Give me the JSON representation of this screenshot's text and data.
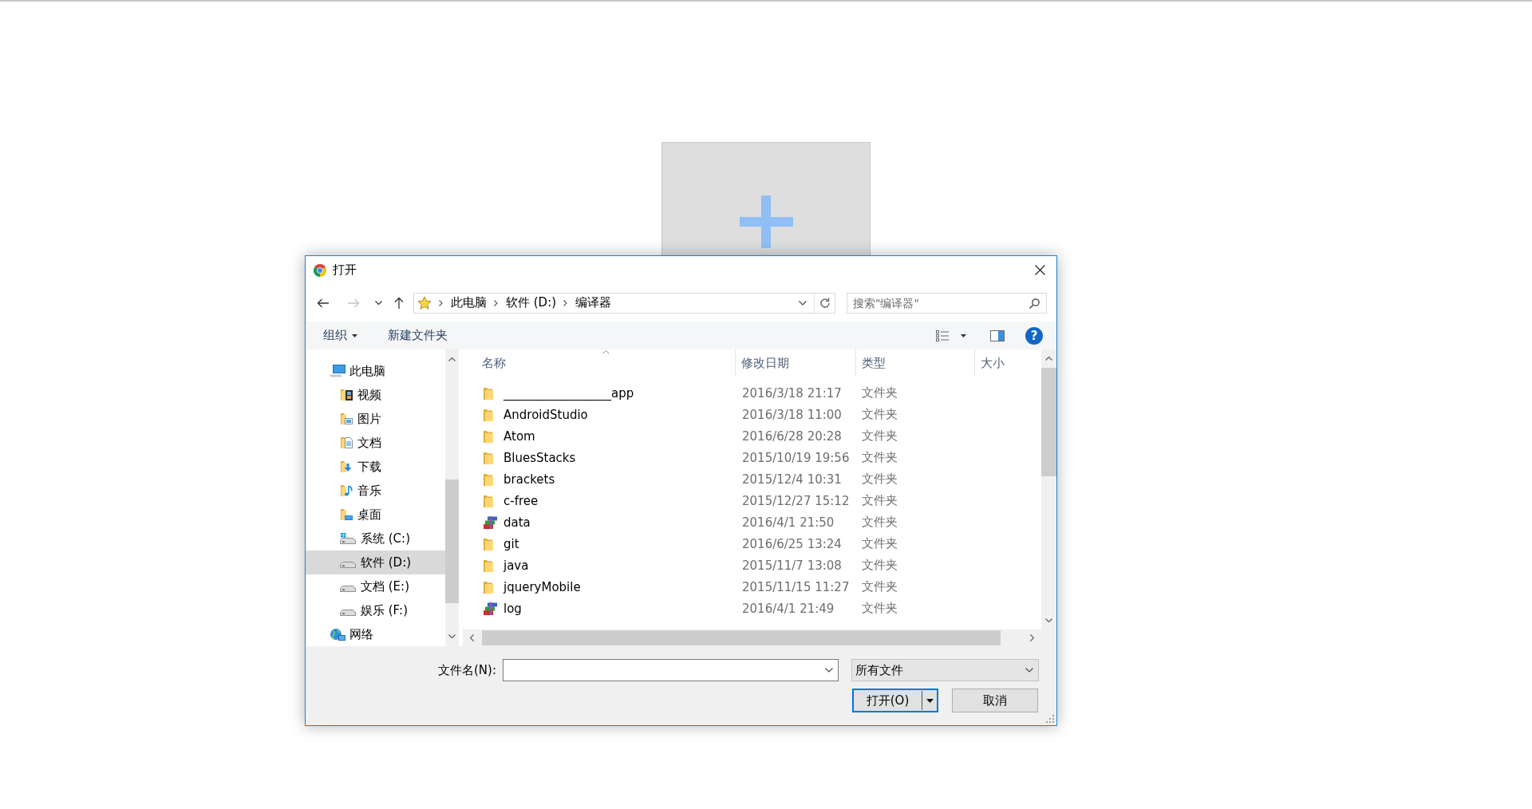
{
  "dialog": {
    "title": "打开",
    "nav": [
      {
        "kind": "back",
        "disabled": false
      },
      {
        "kind": "forward",
        "disabled": true
      },
      {
        "kind": "recent",
        "disabled": false
      },
      {
        "kind": "up",
        "disabled": false
      }
    ],
    "breadcrumb": [
      "此电脑",
      "软件 (D:)",
      "编译器"
    ],
    "search": {
      "placeholder": "搜索\"编译器\""
    },
    "toolbar": {
      "organize": "组织",
      "new_folder": "新建文件夹",
      "help": "?"
    },
    "sidebar": {
      "items": [
        {
          "label": "此电脑",
          "kind": "computer",
          "selected": false,
          "children": [
            {
              "label": "视频",
              "kind": "videos",
              "selected": false
            },
            {
              "label": "图片",
              "kind": "pictures",
              "selected": false
            },
            {
              "label": "文档",
              "kind": "documents",
              "selected": false
            },
            {
              "label": "下载",
              "kind": "downloads",
              "selected": false
            },
            {
              "label": "音乐",
              "kind": "music",
              "selected": false
            },
            {
              "label": "桌面",
              "kind": "desktop",
              "selected": false
            },
            {
              "label": "系统 (C:)",
              "kind": "systemdrive",
              "selected": false
            },
            {
              "label": "软件 (D:)",
              "kind": "drive",
              "selected": true
            },
            {
              "label": "文档 (E:)",
              "kind": "drive",
              "selected": false
            },
            {
              "label": "娱乐 (F:)",
              "kind": "drive",
              "selected": false
            }
          ]
        },
        {
          "label": "网络",
          "kind": "network",
          "selected": false
        }
      ]
    },
    "columns": [
      {
        "label": "名称",
        "sorted": true
      },
      {
        "label": "修改日期",
        "sorted": false
      },
      {
        "label": "类型",
        "sorted": false
      },
      {
        "label": "大小",
        "sorted": false
      }
    ],
    "files": [
      {
        "name": "__________________app",
        "modified": "2016/3/18 21:17",
        "type": "文件夹",
        "kind": "folder"
      },
      {
        "name": "AndroidStudio",
        "modified": "2016/3/18 11:00",
        "type": "文件夹",
        "kind": "folder"
      },
      {
        "name": "Atom",
        "modified": "2016/6/28 20:28",
        "type": "文件夹",
        "kind": "folder"
      },
      {
        "name": "BluesStacks",
        "modified": "2015/10/19 19:56",
        "type": "文件夹",
        "kind": "folder"
      },
      {
        "name": "brackets",
        "modified": "2015/12/4 10:31",
        "type": "文件夹",
        "kind": "folder"
      },
      {
        "name": "c-free",
        "modified": "2015/12/27 15:12",
        "type": "文件夹",
        "kind": "folder"
      },
      {
        "name": "data",
        "modified": "2016/4/1 21:50",
        "type": "文件夹",
        "kind": "archive"
      },
      {
        "name": "git",
        "modified": "2016/6/25 13:24",
        "type": "文件夹",
        "kind": "folder"
      },
      {
        "name": "java",
        "modified": "2015/11/7 13:08",
        "type": "文件夹",
        "kind": "folder"
      },
      {
        "name": "jqueryMobile",
        "modified": "2015/11/15 11:27",
        "type": "文件夹",
        "kind": "folder"
      },
      {
        "name": "log",
        "modified": "2016/4/1 21:49",
        "type": "文件夹",
        "kind": "archive"
      }
    ],
    "filename": {
      "label": "文件名(N):"
    },
    "file_type": {
      "value": "所有文件"
    },
    "buttons": [
      {
        "label": "打开(O)",
        "kind": "split",
        "default": true
      },
      {
        "label": "取消",
        "kind": "plain",
        "default": false
      }
    ]
  }
}
